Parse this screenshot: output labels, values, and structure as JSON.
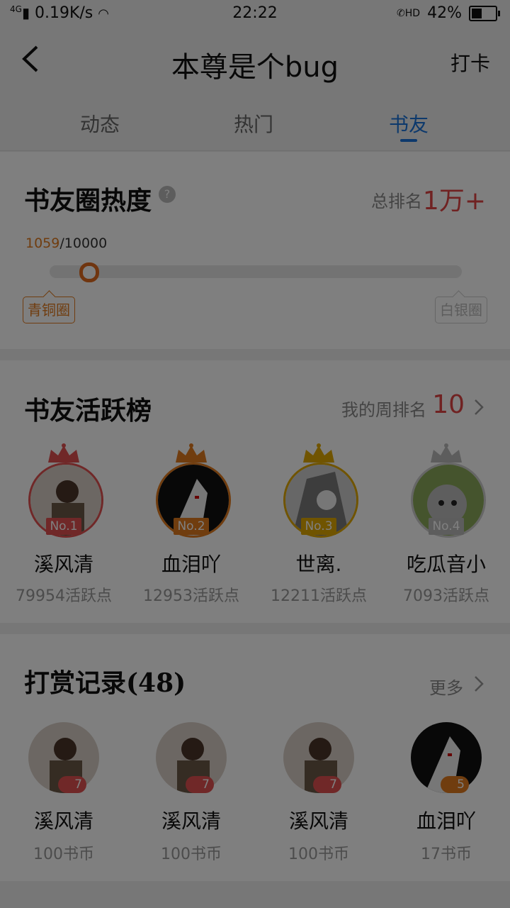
{
  "status_bar": {
    "network": "0.19K/s",
    "time": "22:22",
    "battery": "42%",
    "signal_type": "4G",
    "call_icon": "HD"
  },
  "header": {
    "title": "本尊是个bug",
    "checkin_label": "打卡"
  },
  "tabs": [
    {
      "label": "动态"
    },
    {
      "label": "热门"
    },
    {
      "label": "书友"
    }
  ],
  "heat": {
    "title": "书友圈热度",
    "help_icon": "?",
    "rank_label": "总排名",
    "rank_value": "1万+",
    "progress_current": "1059",
    "progress_total": "/10000",
    "progress_fraction": 0.1059,
    "level_current": "青铜圈",
    "level_next": "白银圈"
  },
  "activity": {
    "title": "书友活跃榜",
    "weekly_rank_label": "我的周排名",
    "weekly_rank_value": "10",
    "items": [
      {
        "badge": "No.1",
        "name": "溪风清",
        "points": "79954活跃点"
      },
      {
        "badge": "No.2",
        "name": "血泪吖",
        "points": "12953活跃点"
      },
      {
        "badge": "No.3",
        "name": "世离.",
        "points": "12211活跃点"
      },
      {
        "badge": "No.4",
        "name": "吃瓜音小",
        "points": "7093活跃点"
      }
    ]
  },
  "rewards": {
    "title": "打赏记录(48)",
    "more_label": "更多",
    "items": [
      {
        "level": "7",
        "name": "溪风清",
        "amount": "100书币"
      },
      {
        "level": "7",
        "name": "溪风清",
        "amount": "100书币"
      },
      {
        "level": "7",
        "name": "溪风清",
        "amount": "100书币"
      },
      {
        "level": "5",
        "name": "血泪吖",
        "amount": "17书币"
      }
    ]
  },
  "colors": {
    "accent_blue": "#1a73d9",
    "accent_red": "#e04545",
    "bronze": "#e07a1f",
    "gold": "#e0a800",
    "silver": "#bbbbbb"
  }
}
